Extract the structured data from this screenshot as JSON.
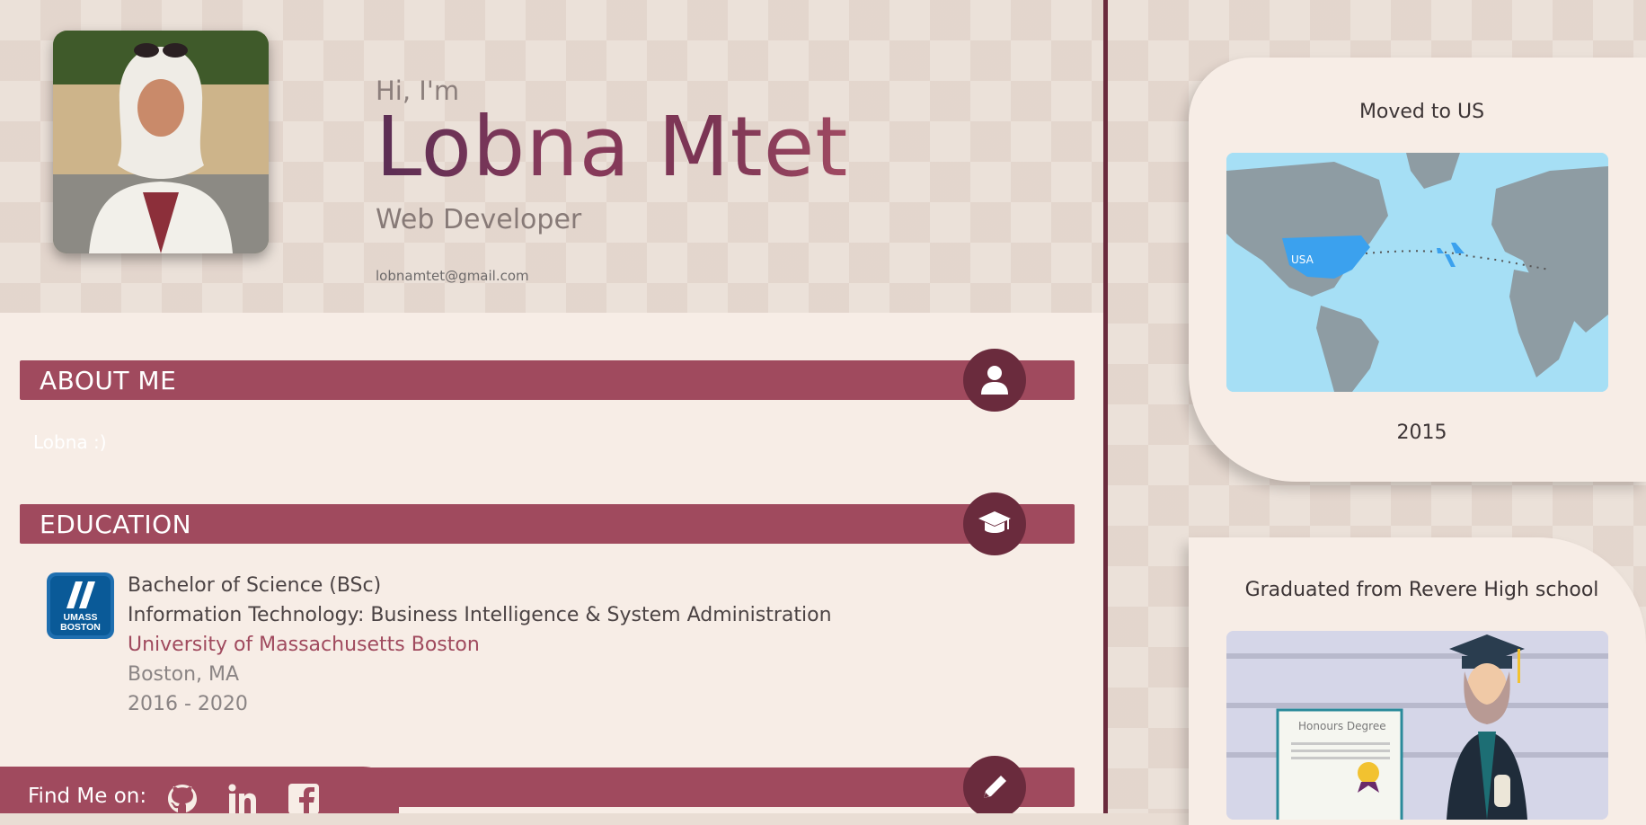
{
  "profile": {
    "greeting": "Hi, I'm",
    "name": "Lobna Mtet",
    "role": "Web Developer",
    "email": "lobnamtet@gmail.com"
  },
  "sections": {
    "about": {
      "title": "ABOUT ME",
      "text": "Lobna :)"
    },
    "education": {
      "title": "EDUCATION"
    }
  },
  "education": {
    "logo_line1": "UMASS",
    "logo_line2": "BOSTON",
    "degree": "Bachelor of Science (BSc)",
    "field": "Information Technology: Business Intelligence & System Administration",
    "school": "University of Massachusetts Boston",
    "location": "Boston, MA",
    "years": "2016 - 2020"
  },
  "footer": {
    "find_me": "Find Me on:",
    "icons": [
      "github-icon",
      "linkedin-icon",
      "facebook-icon"
    ]
  },
  "timeline": [
    {
      "title": "Moved to US",
      "map_label": "USA",
      "year": "2015"
    },
    {
      "title": "Graduated from Revere High school",
      "certificate_label": "Honours Degree"
    }
  ],
  "colors": {
    "accent": "#a04a5e",
    "accent_dark": "#6a2b3d",
    "background": "#f7ede6",
    "name_gradient_start": "#5a2d53",
    "name_gradient_end": "#a04a62"
  }
}
